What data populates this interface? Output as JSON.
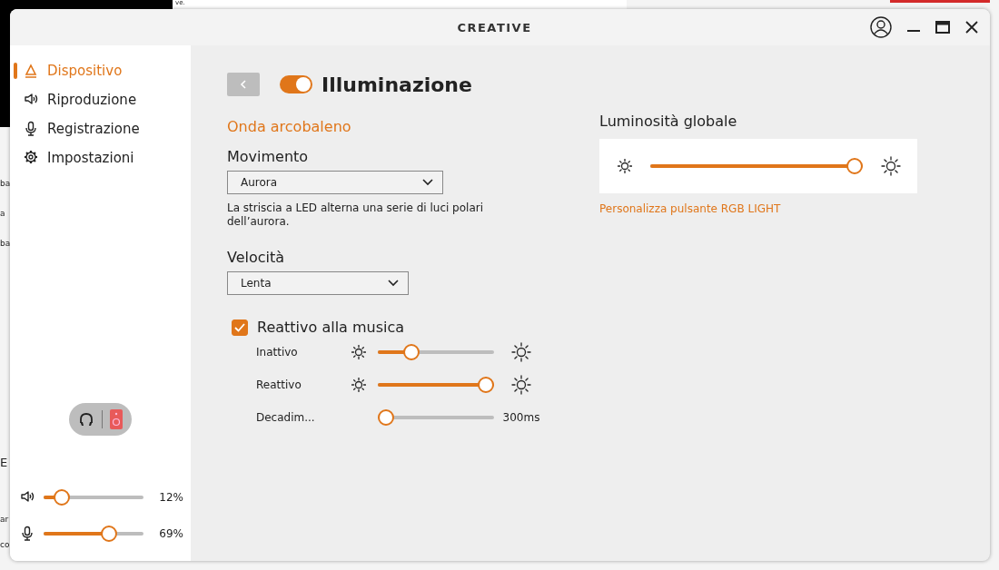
{
  "background": {
    "fragments": [
      "ve.",
      "ba",
      "a",
      "ba",
      "E",
      "ar",
      "co"
    ]
  },
  "window": {
    "logo": "CREATIVE"
  },
  "sidebar": {
    "items": [
      {
        "label": "Dispositivo",
        "kind": "device",
        "selected": true
      },
      {
        "label": "Riproduzione",
        "kind": "speaker",
        "selected": false
      },
      {
        "label": "Registrazione",
        "kind": "mic",
        "selected": false
      },
      {
        "label": "Impostazioni",
        "kind": "gear",
        "selected": false
      }
    ]
  },
  "output_switch": {
    "options": [
      {
        "kind": "headphones",
        "selected": false
      },
      {
        "kind": "speaker",
        "selected": true
      }
    ]
  },
  "volume": [
    {
      "kind": "speaker",
      "level": 0.12,
      "reading": "12%"
    },
    {
      "kind": "mic",
      "level": 0.69,
      "reading": "69%"
    }
  ],
  "header": {
    "title": "Illuminazione",
    "on": true
  },
  "effect": "Onda arcobaleno",
  "fields": [
    {
      "label": "Movimento",
      "value": "Aurora",
      "description": "La striscia a LED alterna una serie di luci polari dell’aurora."
    },
    {
      "label": "Velocità",
      "value": "Lenta"
    }
  ],
  "music_reactive": {
    "label": "Reattivo alla musica",
    "checked": true,
    "sliders": [
      {
        "kind": "brightness",
        "label": "Inattivo",
        "level": 0.25
      },
      {
        "kind": "brightness",
        "label": "Reattivo",
        "level": 1.0
      },
      {
        "kind": "time",
        "label": "Decadim...",
        "level": 0.0,
        "reading": "300ms"
      }
    ]
  },
  "global_brightness": {
    "title": "Luminosità globale",
    "level": 1.0,
    "link": "Personalizza pulsante RGB LIGHT"
  }
}
